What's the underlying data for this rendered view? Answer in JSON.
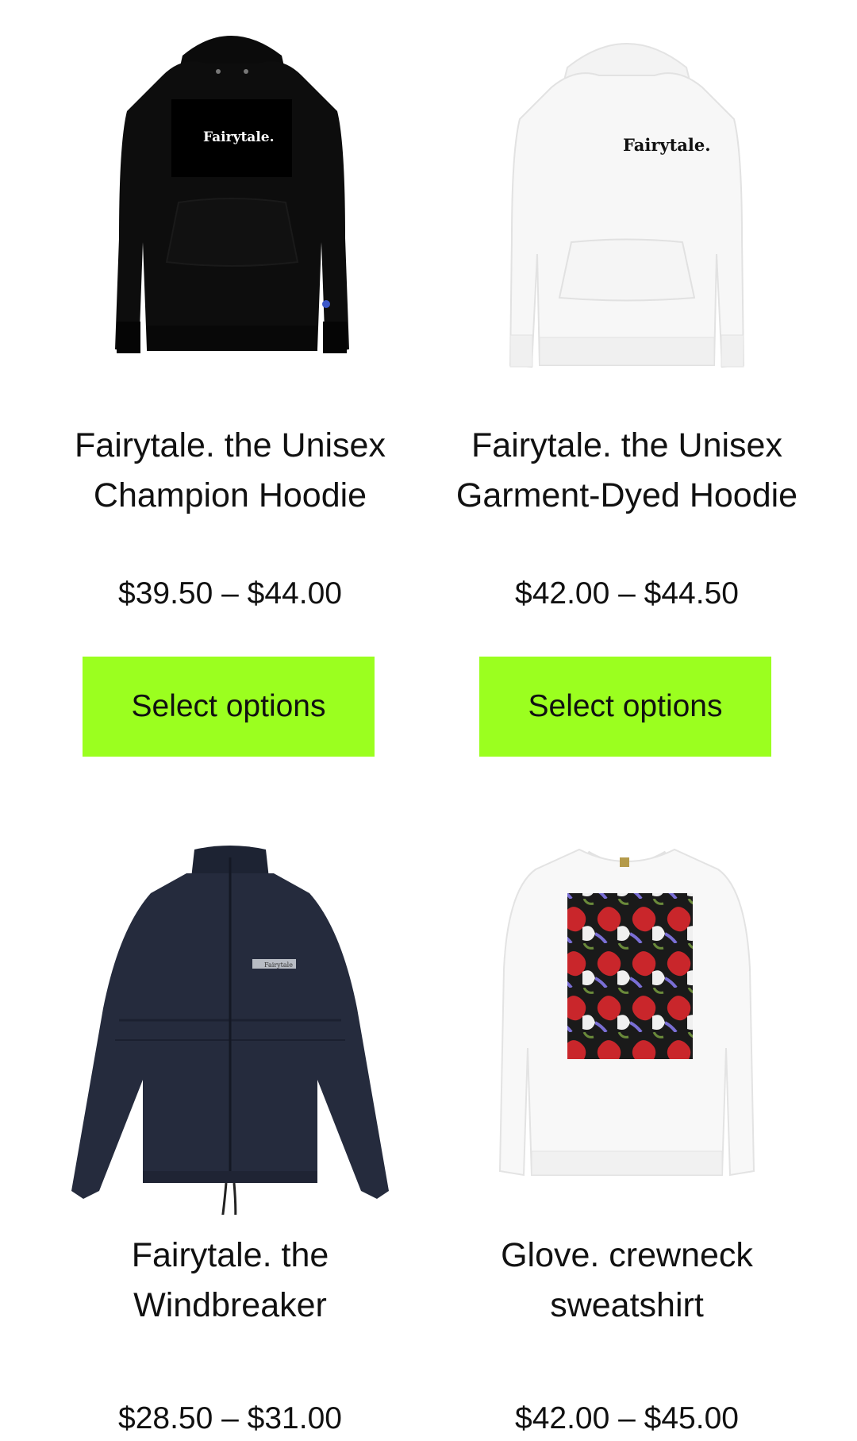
{
  "products": [
    {
      "title": "Fairytale. the Unisex Champion Hoodie",
      "price": "$39.50 – $44.00",
      "button": "Select options",
      "print_text": "Fairytale."
    },
    {
      "title": "Fairytale. the Unisex Garment-Dyed Hoodie",
      "price": "$42.00 – $44.50",
      "button": "Select options",
      "print_text": "Fairytale."
    },
    {
      "title": "Fairytale. the Windbreaker",
      "price": "$28.50 – $31.00",
      "print_text": "Fairytale"
    },
    {
      "title": "Glove. crewneck sweatshirt",
      "price": "$42.00 – $45.00"
    }
  ],
  "colors": {
    "button_bg": "#9bff1f",
    "text": "#111111"
  }
}
